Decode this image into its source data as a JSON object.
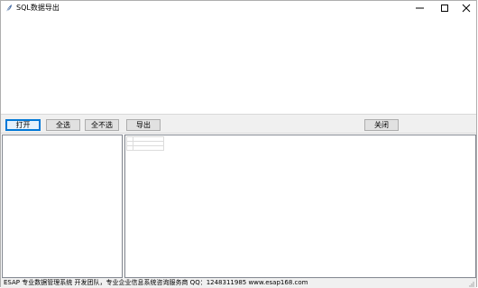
{
  "window": {
    "title": "SQL数据导出",
    "controls": [
      "minimize",
      "maximize",
      "close"
    ]
  },
  "toolbar": {
    "open_label": "打开",
    "select_all_label": "全选",
    "select_none_label": "全不选",
    "export_label": "导出",
    "close_label": "关闭"
  },
  "statusbar": {
    "text": "ESAP 专业数据管理系统 开发团队，专业企业信息系统咨询服务商   QQ：1248311985     www.esap168.com"
  },
  "colors": {
    "toolbar_bg": "#f0f0f0",
    "focus_border": "#0078d7",
    "pane_border": "#828790"
  }
}
